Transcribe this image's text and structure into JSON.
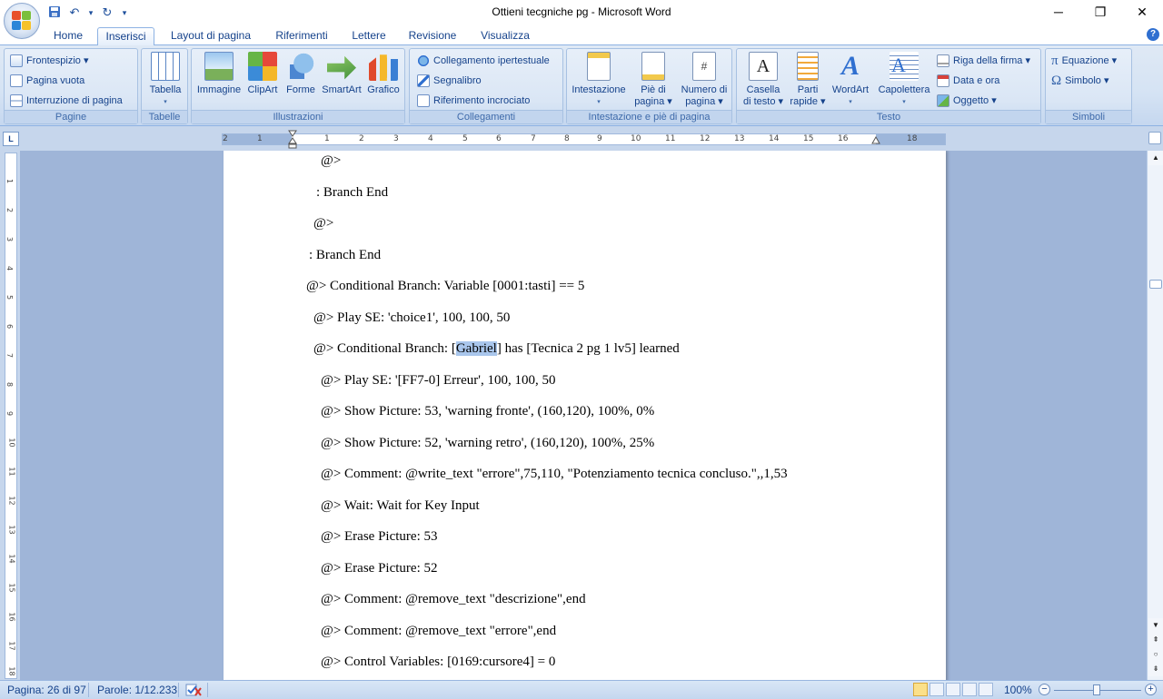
{
  "window": {
    "title": "Ottieni tecgniche pg - Microsoft Word",
    "controls": [
      "─",
      "❐",
      "✕"
    ]
  },
  "quick_access": [
    {
      "name": "save-icon",
      "glyph": "▪"
    },
    {
      "name": "undo-icon",
      "glyph": "↶"
    },
    {
      "name": "undo-dropdown-icon",
      "glyph": "▾"
    },
    {
      "name": "redo-icon",
      "glyph": "↻"
    },
    {
      "name": "customize-qat-icon",
      "glyph": "▾"
    }
  ],
  "tabs": [
    {
      "label": "Home",
      "active": false
    },
    {
      "label": "Inserisci",
      "active": true
    },
    {
      "label": "Layout di pagina",
      "active": false
    },
    {
      "label": "Riferimenti",
      "active": false
    },
    {
      "label": "Lettere",
      "active": false
    },
    {
      "label": "Revisione",
      "active": false
    },
    {
      "label": "Visualizza",
      "active": false
    }
  ],
  "ribbon": {
    "pagine": {
      "label": "Pagine",
      "items": [
        "Frontespizio ▾",
        "Pagina vuota",
        "Interruzione di pagina"
      ]
    },
    "tabelle": {
      "label": "Tabelle",
      "tabella": "Tabella",
      "caret": "▾"
    },
    "illustrazioni": {
      "label": "Illustrazioni",
      "items": [
        "Immagine",
        "ClipArt",
        "Forme",
        "SmartArt",
        "Grafico"
      ]
    },
    "collegamenti": {
      "label": "Collegamenti",
      "items": [
        "Collegamento ipertestuale",
        "Segnalibro",
        "Riferimento incrociato"
      ]
    },
    "intestazione": {
      "label": "Intestazione e piè di pagina",
      "items": [
        {
          "line1": "Intestazione",
          "line2": "▾"
        },
        {
          "line1": "Piè di",
          "line2": "pagina ▾"
        },
        {
          "line1": "Numero di",
          "line2": "pagina ▾"
        }
      ]
    },
    "testo": {
      "label": "Testo",
      "items": [
        {
          "line1": "Casella",
          "line2": "di testo ▾"
        },
        {
          "line1": "Parti",
          "line2": "rapide ▾"
        },
        {
          "line1": "WordArt",
          "line2": "▾"
        },
        {
          "line1": "Capolettera",
          "line2": "▾"
        }
      ],
      "small_items": [
        "Riga della firma ▾",
        "Data e ora",
        "Oggetto ▾"
      ]
    },
    "simboli": {
      "label": "Simboli",
      "items": [
        "Equazione ▾",
        "Simbolo ▾"
      ]
    }
  },
  "ruler": {
    "corner": "L",
    "labels": [
      "2",
      "1",
      "1",
      "2",
      "3",
      "4",
      "5",
      "6",
      "7",
      "8",
      "9",
      "10",
      "11",
      "12",
      "13",
      "14",
      "15",
      "16",
      "18"
    ],
    "vlabels": [
      "1",
      "2",
      "3",
      "4",
      "5",
      "6",
      "7",
      "8",
      "9",
      "10",
      "11",
      "12",
      "13",
      "14",
      "15",
      "16",
      "17",
      "18"
    ]
  },
  "document": {
    "lines": [
      {
        "text": "@>"
      },
      {
        "text": ": Branch End"
      },
      {
        "text": "@>"
      },
      {
        "text": ": Branch End"
      },
      {
        "text": "@> Conditional Branch: Variable [0001:tasti] == 5"
      },
      {
        "text": "@> Play SE: 'choice1', 100, 100, 50"
      },
      {
        "pre": "@> Conditional Branch: [",
        "selected": "Gabriel",
        "post": "] has [Tecnica  2 pg 1 lv5] learned"
      },
      {
        "text": "@> Play SE: '[FF7-0] Erreur', 100, 100, 50"
      },
      {
        "text": "@> Show Picture: 53, 'warning fronte', (160,120), 100%, 0%"
      },
      {
        "text": "@> Show Picture: 52, 'warning retro', (160,120), 100%, 25%"
      },
      {
        "text": "@> Comment: @write_text \"errore\",75,110,  \"Potenziamento tecnica concluso.\",,1,53"
      },
      {
        "text": "@> Wait: Wait for Key Input"
      },
      {
        "text": "@> Erase Picture: 53"
      },
      {
        "text": "@> Erase Picture: 52"
      },
      {
        "text": "@> Comment: @remove_text \"descrizione\",end"
      },
      {
        "text": "@> Comment: @remove_text \"errore\",end"
      },
      {
        "text": "@> Control Variables: [0169:cursore4]  = 0"
      }
    ]
  },
  "statusbar": {
    "page": "Pagina: 26 di 97",
    "words": "Parole: 1/12.233",
    "zoom": "100%",
    "zoom_minus": "−",
    "zoom_plus": "+"
  },
  "scrollbar": {
    "up": "▲",
    "down": "▼",
    "prev_page": "⇞",
    "browse": "○",
    "next_page": "⇟"
  }
}
